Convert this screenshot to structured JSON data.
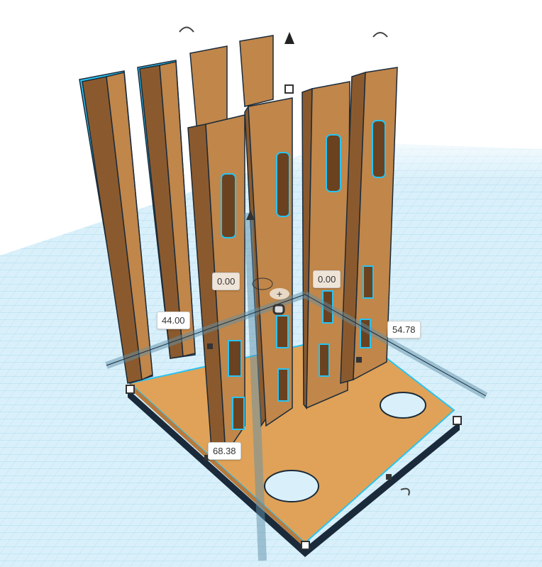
{
  "viewport": {
    "dimensions": {
      "elevation_left": "0.00",
      "elevation_right": "0.00",
      "width": "44.00",
      "depth": "54.78",
      "height": "68.38"
    },
    "colors": {
      "shape": "#c0864a",
      "shape_side": "#8a5a2e",
      "plate": "#e0a258",
      "selection": "#29c3f2",
      "grid": "#bfe3f2"
    }
  }
}
